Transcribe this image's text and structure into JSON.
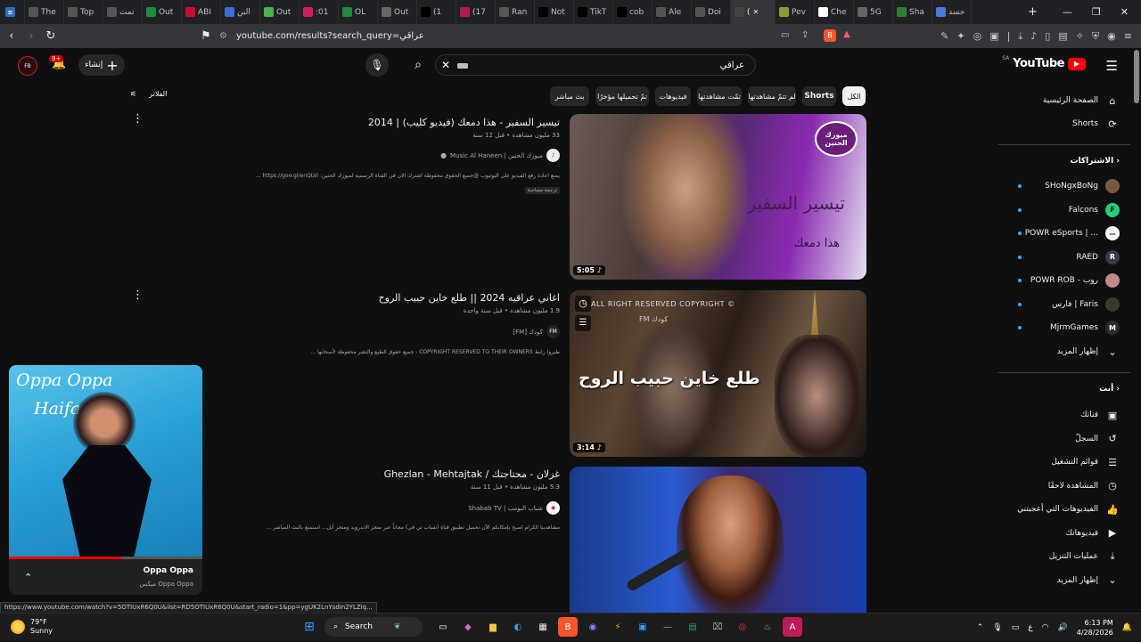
{
  "browser": {
    "tabs": [
      {
        "label": "",
        "icon": "vscode-icon",
        "color": "#2b6fc7"
      },
      {
        "label": "The",
        "icon": "newspaper-icon",
        "color": "#555555"
      },
      {
        "label": "Top",
        "icon": "newspaper-icon",
        "color": "#555555"
      },
      {
        "label": "تمت",
        "icon": "newspaper-icon",
        "color": "#555555"
      },
      {
        "label": "Out",
        "icon": "sheet-icon",
        "color": "#1f8a3a"
      },
      {
        "label": "ABI",
        "icon": "app-icon",
        "color": "#c8102e"
      },
      {
        "label": "البن",
        "icon": "doc-icon",
        "color": "#3d6ad6"
      },
      {
        "label": "Out",
        "icon": "leaf-icon",
        "color": "#4caf50"
      },
      {
        "label": ":01",
        "icon": "record-icon",
        "color": "#d81b60"
      },
      {
        "label": "OL",
        "icon": "sheet-icon",
        "color": "#1f8a3a"
      },
      {
        "label": "Out",
        "icon": "globe-icon",
        "color": "#666666"
      },
      {
        "label": "(1",
        "icon": "x-icon",
        "color": "#000000"
      },
      {
        "label": "(17",
        "icon": "app-icon",
        "color": "#b1165d"
      },
      {
        "label": "Ran",
        "icon": "pin-icon",
        "color": "#555555"
      },
      {
        "label": "Not",
        "icon": "x-icon",
        "color": "#000000"
      },
      {
        "label": "TikT",
        "icon": "tiktok-icon",
        "color": "#000000"
      },
      {
        "label": "cob",
        "icon": "tiktok-icon",
        "color": "#000000"
      },
      {
        "label": "Ale",
        "icon": "pin-icon",
        "color": "#555555"
      },
      {
        "label": "Doi",
        "icon": "arrow-icon",
        "color": "#555555"
      },
      {
        "label": "(",
        "icon": "speaker-icon",
        "color": "#444444",
        "active": true
      },
      {
        "label": "Pev",
        "icon": "circle-icon",
        "color": "#8a9a3a"
      },
      {
        "label": "Che",
        "icon": "chatgpt-icon",
        "color": "#ffffff"
      },
      {
        "label": "5G",
        "icon": "globe-icon",
        "color": "#666666"
      },
      {
        "label": "Sha",
        "icon": "leaf-icon",
        "color": "#2e7d32"
      },
      {
        "label": "حسد",
        "icon": "gemini-icon",
        "color": "#4a7bd6"
      }
    ],
    "new_tab": "+",
    "window_controls": [
      "—",
      "❐",
      "✕"
    ],
    "url": "youtube.com/results?search_query=عراقي"
  },
  "header": {
    "logo_text": "YouTube",
    "logo_region": "SA",
    "search_query": "عراقي",
    "create_label": "إنشاء",
    "notification_count": "9+",
    "avatar_text": "FB"
  },
  "chips": [
    {
      "label": "الكل",
      "selected": true
    },
    {
      "label": "Shorts"
    },
    {
      "label": "لم تتمّ مشاهدتها"
    },
    {
      "label": "تمّت مشاهدتها"
    },
    {
      "label": "فيديوهات"
    },
    {
      "label": "تمّ تحميلها مؤخرًا"
    },
    {
      "label": "بث مباشر"
    }
  ],
  "filters_label": "الفلاتر",
  "videos": [
    {
      "title": "تيسير السفير - هذا دمعك (فيديو كليب) | 2014",
      "meta": "33 مليون مشاهدة • قبل 12 سنة",
      "channel": "ميوزك الحنين | Music Al Haneen",
      "verified": true,
      "description": "يمنع اعادة رفع الفيديو على اليوتيوب @جميع الحقوق محفوظة اشترك الان في القناة الرسمية لميوزك الحنين: https://goo.gl/enQLVi ...",
      "tag": "ترجمة مصاحبة",
      "duration": "5:05",
      "thumb_badge": "ميوزك الحنين",
      "thumb_title": "تيسير السفير",
      "thumb_sub": "هذا دمعك"
    },
    {
      "title": "اغاني عراقيه 2024 || طلع خاين حبيب الروح",
      "meta": "1.9 مليون مشاهدة • قبل سنة واحدة",
      "channel": "كودك [FM]",
      "description": "طيروا رابط COPYRIGHT RESERVED TO THEIR OWNERS - جميع حقوق الطبع والنشر محفوظة لأصحابها ...",
      "duration": "3:14",
      "thumb_top": "ALL RIGHT RESERVED COPYRIGHT ©",
      "thumb_sub": "كودك FM",
      "thumb_title": "طلع خاين حبيب الروح"
    },
    {
      "title": "غزلان - محتاجتك / Ghezlan - Mehtajtak",
      "meta": "5.3 مليون مشاهدة • قبل 11 سنة",
      "channel": "شباب البومب | Shabab TV",
      "description": "مشاهدينا الكرام اصبح بإمكانكم الآن تحميل تطبيق قناة (شباب تي في) مجاناً عبر متجر الاندرويد ومتجر آبل... استمتع بالبث المباشر ..."
    }
  ],
  "sidebar": {
    "home": "الصفحة الرئيسية",
    "shorts": "Shorts",
    "subs_header": "الاشتراكات",
    "subscriptions": [
      {
        "label": "SHoNgxBoNg",
        "color": "#7a5a3c",
        "mark": ""
      },
      {
        "label": "Falcons",
        "color": "#1fd17a",
        "mark": "F"
      },
      {
        "label": "POWR eSports | ...",
        "color": "#ffffff",
        "mark": "—"
      },
      {
        "label": "RAED",
        "color": "#3a3a4a",
        "mark": "R"
      },
      {
        "label": "POWR ROB - روب",
        "color": "#c08a8a",
        "mark": ""
      },
      {
        "label": "فارس | Faris",
        "color": "#3a3a2a",
        "mark": ""
      },
      {
        "label": "MjrmGames",
        "color": "#2a2a2a",
        "mark": "M"
      }
    ],
    "show_more": "إظهار المزيد",
    "you_header": "أنت",
    "you_items": [
      {
        "label": "قناتك",
        "icon": "person-icon",
        "glyph": "▣"
      },
      {
        "label": "السجلّ",
        "icon": "history-icon",
        "glyph": "↺"
      },
      {
        "label": "قوائم التشغيل",
        "icon": "playlist-icon",
        "glyph": "☰"
      },
      {
        "label": "المشاهدة لاحقًا",
        "icon": "clock-icon",
        "glyph": "◷"
      },
      {
        "label": "الفيديوهات التي أعجبتني",
        "icon": "thumbs-up-icon",
        "glyph": "👍"
      },
      {
        "label": "فيديوهاتك",
        "icon": "video-icon",
        "glyph": "▶"
      },
      {
        "label": "عمليات التنزيل",
        "icon": "download-icon",
        "glyph": "⤓"
      },
      {
        "label": "إظهار المزيد",
        "icon": "chevron-down-icon",
        "glyph": "⌄"
      }
    ]
  },
  "miniplayer": {
    "title": "Oppa Oppa",
    "subtitle": "ميكس Oppa Oppa",
    "art_text": "Oppa Oppa",
    "art_sub": "Haifa",
    "progress": 0.58
  },
  "status_url": "https://www.youtube.com/watch?v=5OTIUxR6Q0U&list=RD5OTIUxR6Q0U&start_radio=1&pp=ygUK2LnYsdin2YLZiq...",
  "taskbar": {
    "weather_temp": "79°F",
    "weather_cond": "Sunny",
    "search_label": "Search",
    "time": "6:13 PM",
    "date": "4/28/2026",
    "lang": "ع"
  }
}
